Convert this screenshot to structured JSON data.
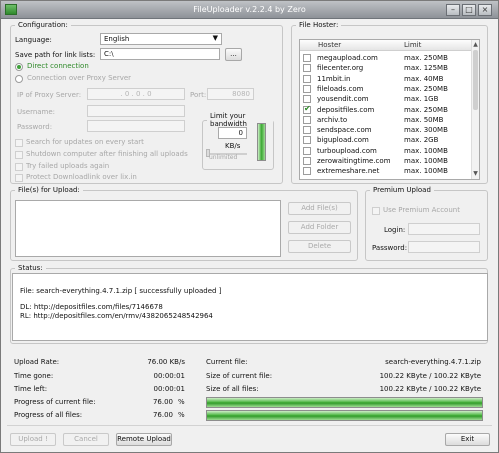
{
  "title": "FileUploader v.2.2.4 by Zero",
  "config": {
    "legend": "Configuration:",
    "language_label": "Language:",
    "language_value": "English",
    "save_path_label": "Save path for link lists:",
    "save_path_value": "C:\\",
    "browse_label": "...",
    "direct_label": "Direct connection",
    "proxy_label": "Connection over Proxy Server",
    "proxy_ip_label": "IP of Proxy Server:",
    "proxy_ip_value": ". 0 . 0 . 0",
    "port_label": "Port:",
    "port_value": "8080",
    "username_label": "Username:",
    "password_label": "Password:",
    "options": [
      "Search for updates on every start",
      "Shutdown computer after finishing all uploads",
      "Try failed uploads again",
      "Protect Downloadlink over lix.in"
    ],
    "bandwidth_legend": "Limit your bandwidth",
    "bandwidth_value": "0",
    "bandwidth_unit": "KB/s",
    "bandwidth_slider_label": "unlimited"
  },
  "hoster": {
    "legend": "File Hoster:",
    "col_hoster": "Hoster",
    "col_limit": "Limit",
    "rows": [
      {
        "name": "megaupload.com",
        "limit": "max. 250MB",
        "checked": false
      },
      {
        "name": "filecenter.org",
        "limit": "max. 125MB",
        "checked": false
      },
      {
        "name": "11mbit.in",
        "limit": "max. 40MB",
        "checked": false
      },
      {
        "name": "fileloads.com",
        "limit": "max. 250MB",
        "checked": false
      },
      {
        "name": "yousendit.com",
        "limit": "max. 1GB",
        "checked": false
      },
      {
        "name": "depositfiles.com",
        "limit": "max. 250MB",
        "checked": true
      },
      {
        "name": "archiv.to",
        "limit": "max. 50MB",
        "checked": false
      },
      {
        "name": "sendspace.com",
        "limit": "max. 300MB",
        "checked": false
      },
      {
        "name": "bigupload.com",
        "limit": "max. 2GB",
        "checked": false
      },
      {
        "name": "turboupload.com",
        "limit": "max. 100MB",
        "checked": false
      },
      {
        "name": "zerowaitingtime.com",
        "limit": "max. 100MB",
        "checked": false
      },
      {
        "name": "extremeshare.net",
        "limit": "max. 100MB",
        "checked": false
      }
    ]
  },
  "files": {
    "legend": "File(s) for Upload:",
    "add_files_label": "Add File(s)",
    "add_folder_label": "Add Folder",
    "delete_label": "Delete"
  },
  "premium": {
    "legend": "Premium Upload",
    "use_premium_label": "Use Premium Account",
    "login_label": "Login:",
    "password_label": "Password:"
  },
  "status": {
    "legend": "Status:",
    "lines": [
      "File: search-everything.4.7.1.zip [ successfully uploaded ]",
      "DL: http://depositfiles.com/files/7146678",
      "RL: http://depositfiles.com/en/rmv/4382065248542964"
    ]
  },
  "stats": {
    "upload_rate_label": "Upload Rate:",
    "upload_rate_value": "76.00 KB/s",
    "time_gone_label": "Time gone:",
    "time_gone_value": "00:00:01",
    "time_left_label": "Time left:",
    "time_left_value": "00:00:01",
    "progress_current_label": "Progress of current file:",
    "progress_current_value": "76.00",
    "progress_all_label": "Progress of all files:",
    "progress_all_value": "76.00",
    "percent_sign": "%",
    "current_file_label": "Current file:",
    "current_file_value": "search-everything.4.7.1.zip",
    "size_current_label": "Size of current file:",
    "size_current_value": "100.22 KByte / 100.22 KByte",
    "size_all_label": "Size of all files:",
    "size_all_value": "100.22 KByte / 100.22 KByte",
    "progress_current_fraction": 1.0,
    "progress_all_fraction": 1.0
  },
  "buttons": {
    "upload": "Upload !",
    "cancel": "Cancel",
    "remote_upload": "Remote Upload",
    "exit": "Exit"
  },
  "colors": {
    "accent_green": "#3fa13a",
    "titlebar": "#a7abb0"
  }
}
